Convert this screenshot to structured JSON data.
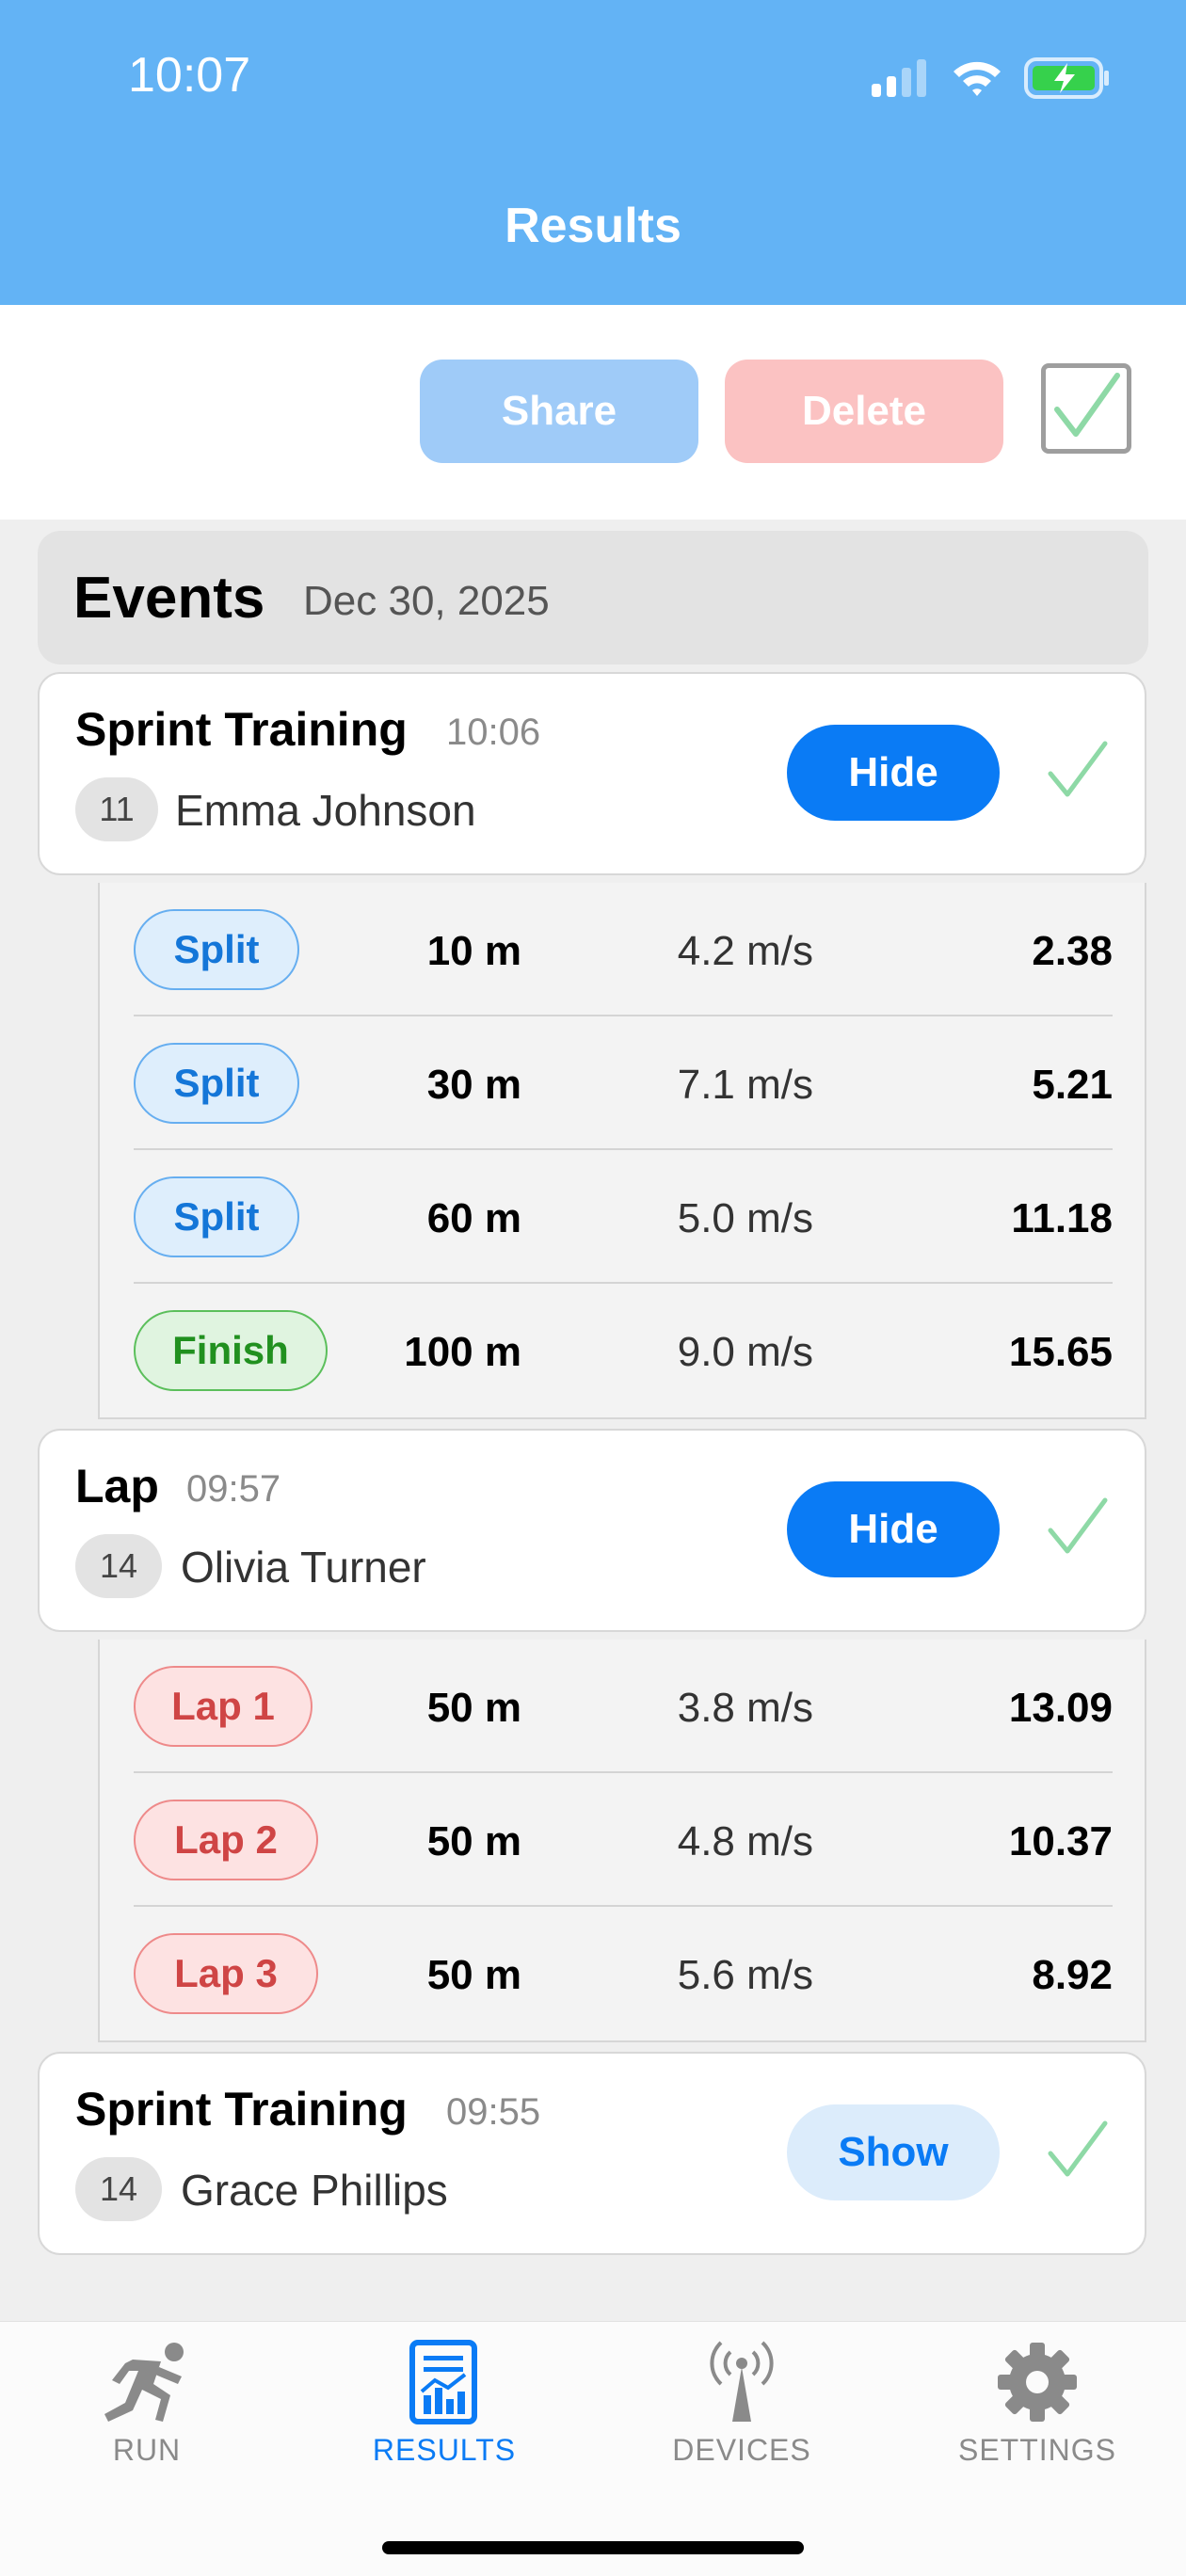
{
  "status_bar": {
    "time": "10:07"
  },
  "header": {
    "title": "Results"
  },
  "toolbar": {
    "share_label": "Share",
    "delete_label": "Delete"
  },
  "events": {
    "title": "Events",
    "date": "Dec 30, 2025"
  },
  "cards": [
    {
      "name": "Sprint Training",
      "time": "10:06",
      "bib": "11",
      "athlete": "Emma Johnson",
      "toggle_label": "Hide",
      "splits": [
        {
          "label": "Split",
          "distance": "10 m",
          "speed": "4.2 m/s",
          "value": "2.38"
        },
        {
          "label": "Split",
          "distance": "30 m",
          "speed": "7.1 m/s",
          "value": "5.21"
        },
        {
          "label": "Split",
          "distance": "60 m",
          "speed": "5.0 m/s",
          "value": "11.18"
        },
        {
          "label": "Finish",
          "distance": "100 m",
          "speed": "9.0 m/s",
          "value": "15.65"
        }
      ]
    },
    {
      "name": "Lap",
      "time": "09:57",
      "bib": "14",
      "athlete": "Olivia Turner",
      "toggle_label": "Hide",
      "splits": [
        {
          "label": "Lap 1",
          "distance": "50 m",
          "speed": "3.8 m/s",
          "value": "13.09"
        },
        {
          "label": "Lap 2",
          "distance": "50 m",
          "speed": "4.8 m/s",
          "value": "10.37"
        },
        {
          "label": "Lap 3",
          "distance": "50 m",
          "speed": "5.6 m/s",
          "value": "8.92"
        }
      ]
    },
    {
      "name": "Sprint Training",
      "time": "09:55",
      "bib": "14",
      "athlete": "Grace Phillips",
      "toggle_label": "Show"
    }
  ],
  "tabs": [
    {
      "label": "RUN",
      "icon": "runner-icon"
    },
    {
      "label": "RESULTS",
      "icon": "chart-document-icon"
    },
    {
      "label": "DEVICES",
      "icon": "antenna-icon"
    },
    {
      "label": "SETTINGS",
      "icon": "gear-icon"
    }
  ],
  "colors": {
    "header_bg": "#63b3f5",
    "accent": "#0a7bf5",
    "split": "#1476d8",
    "finish": "#21901f",
    "lap": "#cf4545",
    "check": "#8ed9a6"
  }
}
